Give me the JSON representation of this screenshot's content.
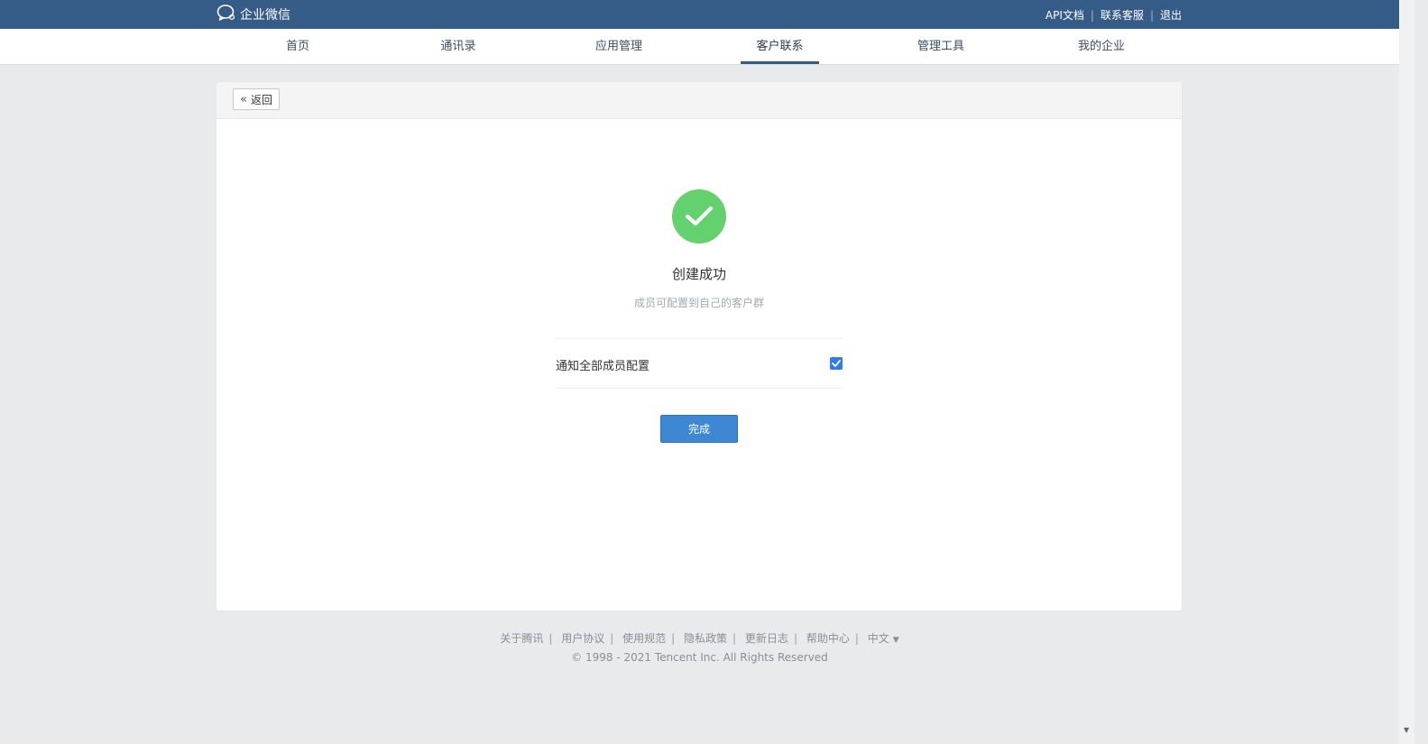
{
  "header": {
    "brand": "企业微信",
    "links": [
      "API文档",
      "联系客服",
      "退出"
    ]
  },
  "nav": {
    "items": [
      "首页",
      "通讯录",
      "应用管理",
      "客户联系",
      "管理工具",
      "我的企业"
    ],
    "active": "客户联系"
  },
  "card": {
    "back_label": "返回",
    "title": "创建成功",
    "subtitle": "成员可配置到自己的客户群",
    "option_label": "通知全部成员配置",
    "option_checked": true,
    "done_label": "完成"
  },
  "footer": {
    "links": [
      "关于腾讯",
      "用户协议",
      "使用规范",
      "隐私政策",
      "更新日志",
      "帮助中心"
    ],
    "language": "中文",
    "copyright": "© 1998 - 2021 Tencent Inc. All Rights Reserved"
  },
  "colors": {
    "topbar": "#355b87",
    "success": "#63d16d",
    "primary_button": "#3d87d3"
  }
}
